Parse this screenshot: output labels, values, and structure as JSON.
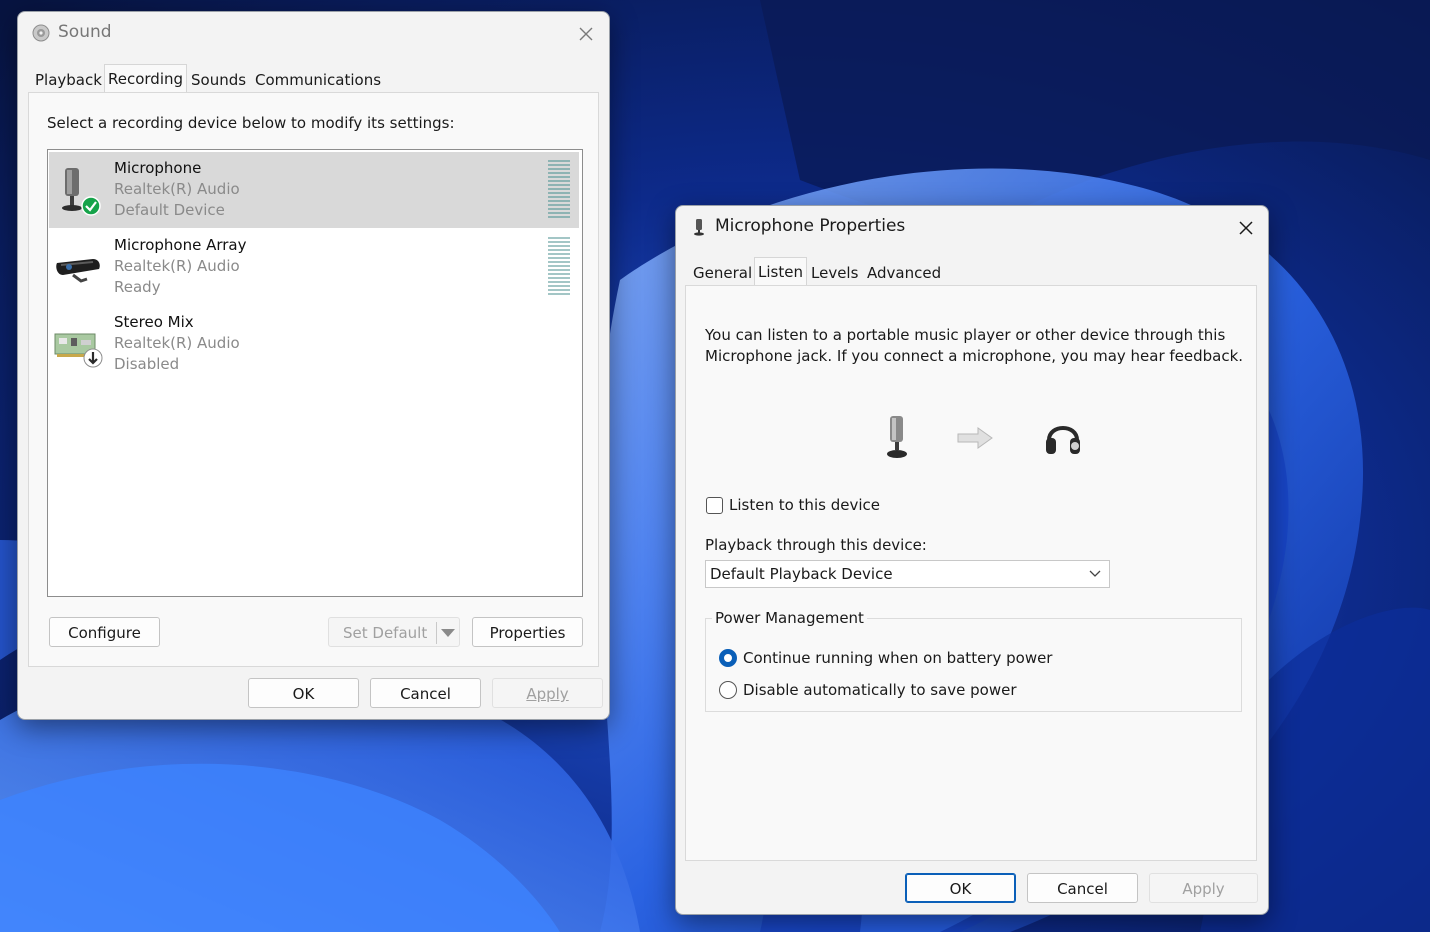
{
  "sound_dialog": {
    "title": "Sound",
    "tabs": [
      "Playback",
      "Recording",
      "Sounds",
      "Communications"
    ],
    "active_tab": "Recording",
    "instruction": "Select a recording device below to modify its settings:",
    "devices": [
      {
        "name": "Microphone",
        "driver": "Realtek(R) Audio",
        "status": "Default Device",
        "selected": true,
        "icon": "microphone-icon"
      },
      {
        "name": "Microphone Array",
        "driver": "Realtek(R) Audio",
        "status": "Ready",
        "selected": false,
        "icon": "webcam-mic-array-icon"
      },
      {
        "name": "Stereo Mix",
        "driver": "Realtek(R) Audio",
        "status": "Disabled",
        "selected": false,
        "icon": "sound-card-icon"
      }
    ],
    "buttons": {
      "configure": "Configure",
      "set_default": "Set Default",
      "properties": "Properties",
      "ok": "OK",
      "cancel": "Cancel",
      "apply": "Apply"
    }
  },
  "properties_dialog": {
    "title": "Microphone Properties",
    "tabs": [
      "General",
      "Listen",
      "Levels",
      "Advanced"
    ],
    "active_tab": "Listen",
    "description_line1": "You can listen to a portable music player or other device through this",
    "description_line2": "Microphone jack.  If you connect a microphone, you may hear feedback.",
    "listen_checkbox_label": "Listen to this device",
    "listen_checked": false,
    "playback_label": "Playback through this device:",
    "playback_value": "Default Playback Device",
    "power_group_label": "Power Management",
    "power_options": [
      {
        "label": "Continue running when on battery power",
        "selected": true
      },
      {
        "label": "Disable automatically to save power",
        "selected": false
      }
    ],
    "buttons": {
      "ok": "OK",
      "cancel": "Cancel",
      "apply": "Apply"
    }
  },
  "colors": {
    "accent": "#0a5fb8",
    "selection_bg": "#d9d9d9",
    "status_green": "#16a34a",
    "wallpaper_dark": "#0b1a4a",
    "wallpaper_bright": "#3a7bff"
  }
}
